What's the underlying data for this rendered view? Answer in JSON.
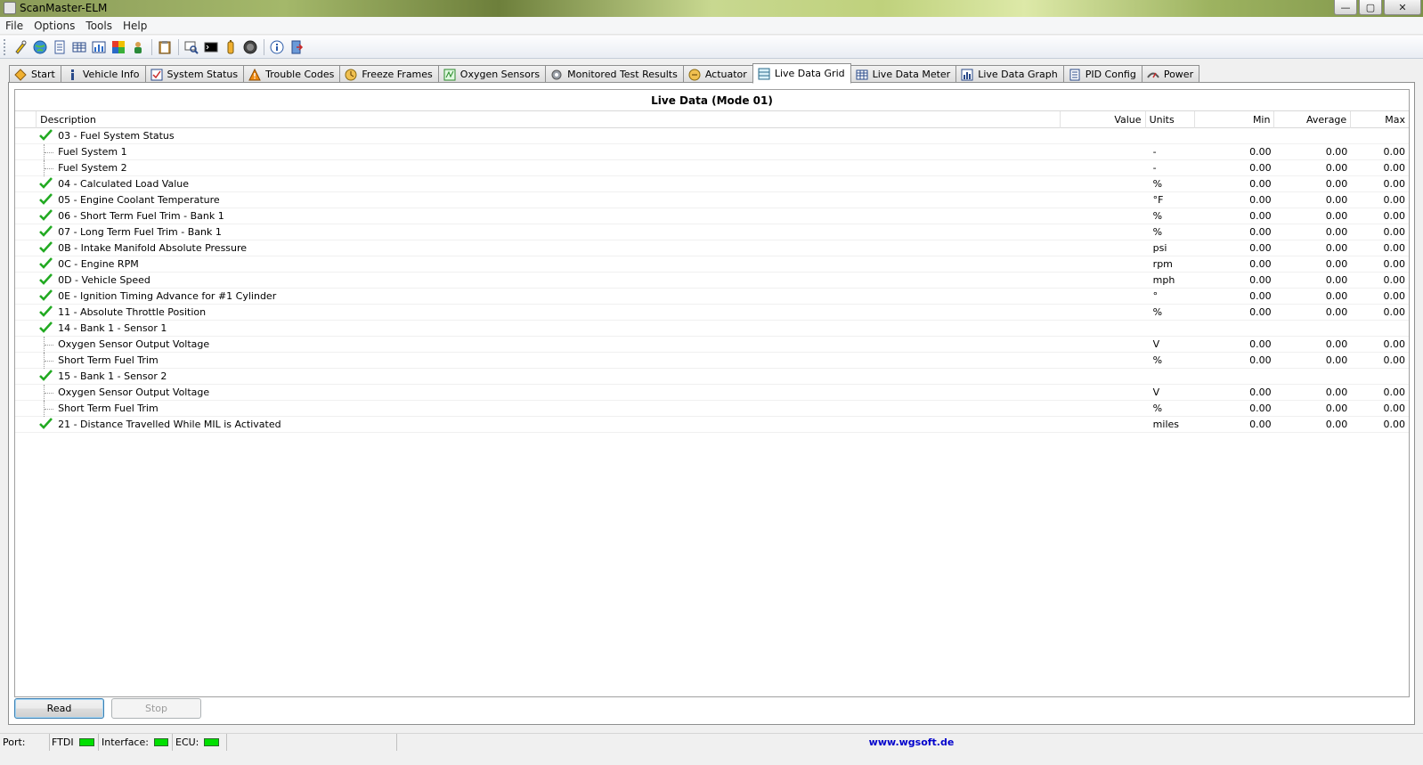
{
  "window": {
    "title": "ScanMaster-ELM",
    "controls": [
      "minimize-icon",
      "maximize-icon",
      "close-icon"
    ]
  },
  "menu": [
    "File",
    "Options",
    "Tools",
    "Help"
  ],
  "toolbar": {
    "icons": [
      "connect-wizard-icon",
      "globe-icon",
      "document-icon",
      "grid-icon",
      "chart-icon",
      "color-chart-icon",
      "person-icon",
      "clipboard-icon",
      "search-icon",
      "terminal-icon",
      "battery-icon",
      "gauge-icon",
      "info-icon",
      "exit-icon"
    ]
  },
  "tabs": [
    {
      "label": "Start",
      "icon": "start-icon"
    },
    {
      "label": "Vehicle Info",
      "icon": "info-icon"
    },
    {
      "label": "System Status",
      "icon": "status-icon"
    },
    {
      "label": "Trouble Codes",
      "icon": "warning-icon"
    },
    {
      "label": "Freeze Frames",
      "icon": "freeze-icon"
    },
    {
      "label": "Oxygen Sensors",
      "icon": "oxygen-icon"
    },
    {
      "label": "Monitored Test Results",
      "icon": "gear-icon"
    },
    {
      "label": "Actuator",
      "icon": "actuator-icon"
    },
    {
      "label": "Live Data Grid",
      "icon": "grid-icon",
      "active": true
    },
    {
      "label": "Live Data Meter",
      "icon": "meter-icon"
    },
    {
      "label": "Live Data Graph",
      "icon": "graph-icon"
    },
    {
      "label": "PID Config",
      "icon": "config-icon"
    },
    {
      "label": "Power",
      "icon": "power-icon"
    }
  ],
  "grid": {
    "title": "Live Data (Mode 01)",
    "headers": {
      "description": "Description",
      "value": "Value",
      "units": "Units",
      "min": "Min",
      "average": "Average",
      "max": "Max"
    },
    "rows": [
      {
        "desc": "03 - Fuel System Status",
        "check": true,
        "value": "",
        "units": "",
        "min": "",
        "avg": "",
        "max": ""
      },
      {
        "desc": "Fuel System 1",
        "child": true,
        "value": "",
        "units": "-",
        "min": "0.00",
        "avg": "0.00",
        "max": "0.00"
      },
      {
        "desc": "Fuel System 2",
        "child": true,
        "value": "",
        "units": "-",
        "min": "0.00",
        "avg": "0.00",
        "max": "0.00"
      },
      {
        "desc": "04 - Calculated Load Value",
        "check": true,
        "value": "",
        "units": "%",
        "min": "0.00",
        "avg": "0.00",
        "max": "0.00"
      },
      {
        "desc": "05 - Engine Coolant Temperature",
        "check": true,
        "value": "",
        "units": "°F",
        "min": "0.00",
        "avg": "0.00",
        "max": "0.00"
      },
      {
        "desc": "06 - Short Term Fuel Trim - Bank 1",
        "check": true,
        "value": "",
        "units": "%",
        "min": "0.00",
        "avg": "0.00",
        "max": "0.00"
      },
      {
        "desc": "07 - Long Term Fuel Trim - Bank 1",
        "check": true,
        "value": "",
        "units": "%",
        "min": "0.00",
        "avg": "0.00",
        "max": "0.00"
      },
      {
        "desc": "0B - Intake Manifold Absolute Pressure",
        "check": true,
        "value": "",
        "units": "psi",
        "min": "0.00",
        "avg": "0.00",
        "max": "0.00"
      },
      {
        "desc": "0C - Engine RPM",
        "check": true,
        "value": "",
        "units": "rpm",
        "min": "0.00",
        "avg": "0.00",
        "max": "0.00"
      },
      {
        "desc": "0D - Vehicle Speed",
        "check": true,
        "value": "",
        "units": "mph",
        "min": "0.00",
        "avg": "0.00",
        "max": "0.00"
      },
      {
        "desc": "0E - Ignition Timing Advance for #1 Cylinder",
        "check": true,
        "value": "",
        "units": "°",
        "min": "0.00",
        "avg": "0.00",
        "max": "0.00"
      },
      {
        "desc": "11 - Absolute Throttle Position",
        "check": true,
        "value": "",
        "units": "%",
        "min": "0.00",
        "avg": "0.00",
        "max": "0.00"
      },
      {
        "desc": "14 - Bank 1 - Sensor 1",
        "check": true,
        "value": "",
        "units": "",
        "min": "",
        "avg": "",
        "max": ""
      },
      {
        "desc": "Oxygen Sensor Output Voltage",
        "child": true,
        "value": "",
        "units": "V",
        "min": "0.00",
        "avg": "0.00",
        "max": "0.00"
      },
      {
        "desc": "Short Term Fuel Trim",
        "child": true,
        "value": "",
        "units": "%",
        "min": "0.00",
        "avg": "0.00",
        "max": "0.00"
      },
      {
        "desc": "15 - Bank 1 - Sensor 2",
        "check": true,
        "value": "",
        "units": "",
        "min": "",
        "avg": "",
        "max": ""
      },
      {
        "desc": "Oxygen Sensor Output Voltage",
        "child": true,
        "value": "",
        "units": "V",
        "min": "0.00",
        "avg": "0.00",
        "max": "0.00"
      },
      {
        "desc": "Short Term Fuel Trim",
        "child": true,
        "value": "",
        "units": "%",
        "min": "0.00",
        "avg": "0.00",
        "max": "0.00"
      },
      {
        "desc": "21 - Distance Travelled While MIL is Activated",
        "check": true,
        "value": "",
        "units": "miles",
        "min": "0.00",
        "avg": "0.00",
        "max": "0.00"
      }
    ]
  },
  "buttons": {
    "read": "Read",
    "stop": "Stop"
  },
  "status": {
    "port": "Port:",
    "ftdi": "FTDI",
    "interface": "Interface:",
    "ecu": "ECU:",
    "link": "www.wgsoft.de"
  },
  "colors": {
    "led_on": "#00e000",
    "check": "#22aa22",
    "link": "#0000cc"
  }
}
